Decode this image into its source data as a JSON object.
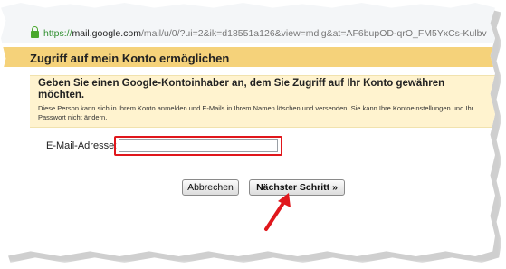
{
  "browser": {
    "url_scheme": "https://",
    "url_host": "mail.google.com",
    "url_path": "/mail/u/0/?ui=2&ik=d18551a126&view=mdlg&at=AF6bupOD-qrO_FM5YxCs-Kulbv",
    "secure_icon": "lock-icon"
  },
  "dialog": {
    "title": "Zugriff auf mein Konto ermöglichen",
    "heading": "Geben Sie einen Google-Kontoinhaber an, dem Sie Zugriff auf Ihr Konto gewähren möchten.",
    "note": "Diese Person kann sich in Ihrem Konto anmelden und E-Mails in Ihrem Namen löschen und versenden. Sie kann Ihre Kontoeinstellungen und Ihr Passwort nicht ändern.",
    "email_label": "E-Mail-Adresse:",
    "email_value": "",
    "cancel_label": "Abbrechen",
    "next_label": "Nächster Schritt »"
  },
  "annotations": {
    "highlight_color": "#e0171c",
    "arrow_icon": "red-arrow-icon"
  },
  "colors": {
    "header_bar": "#f5d27a",
    "panel": "#fff3cf"
  }
}
